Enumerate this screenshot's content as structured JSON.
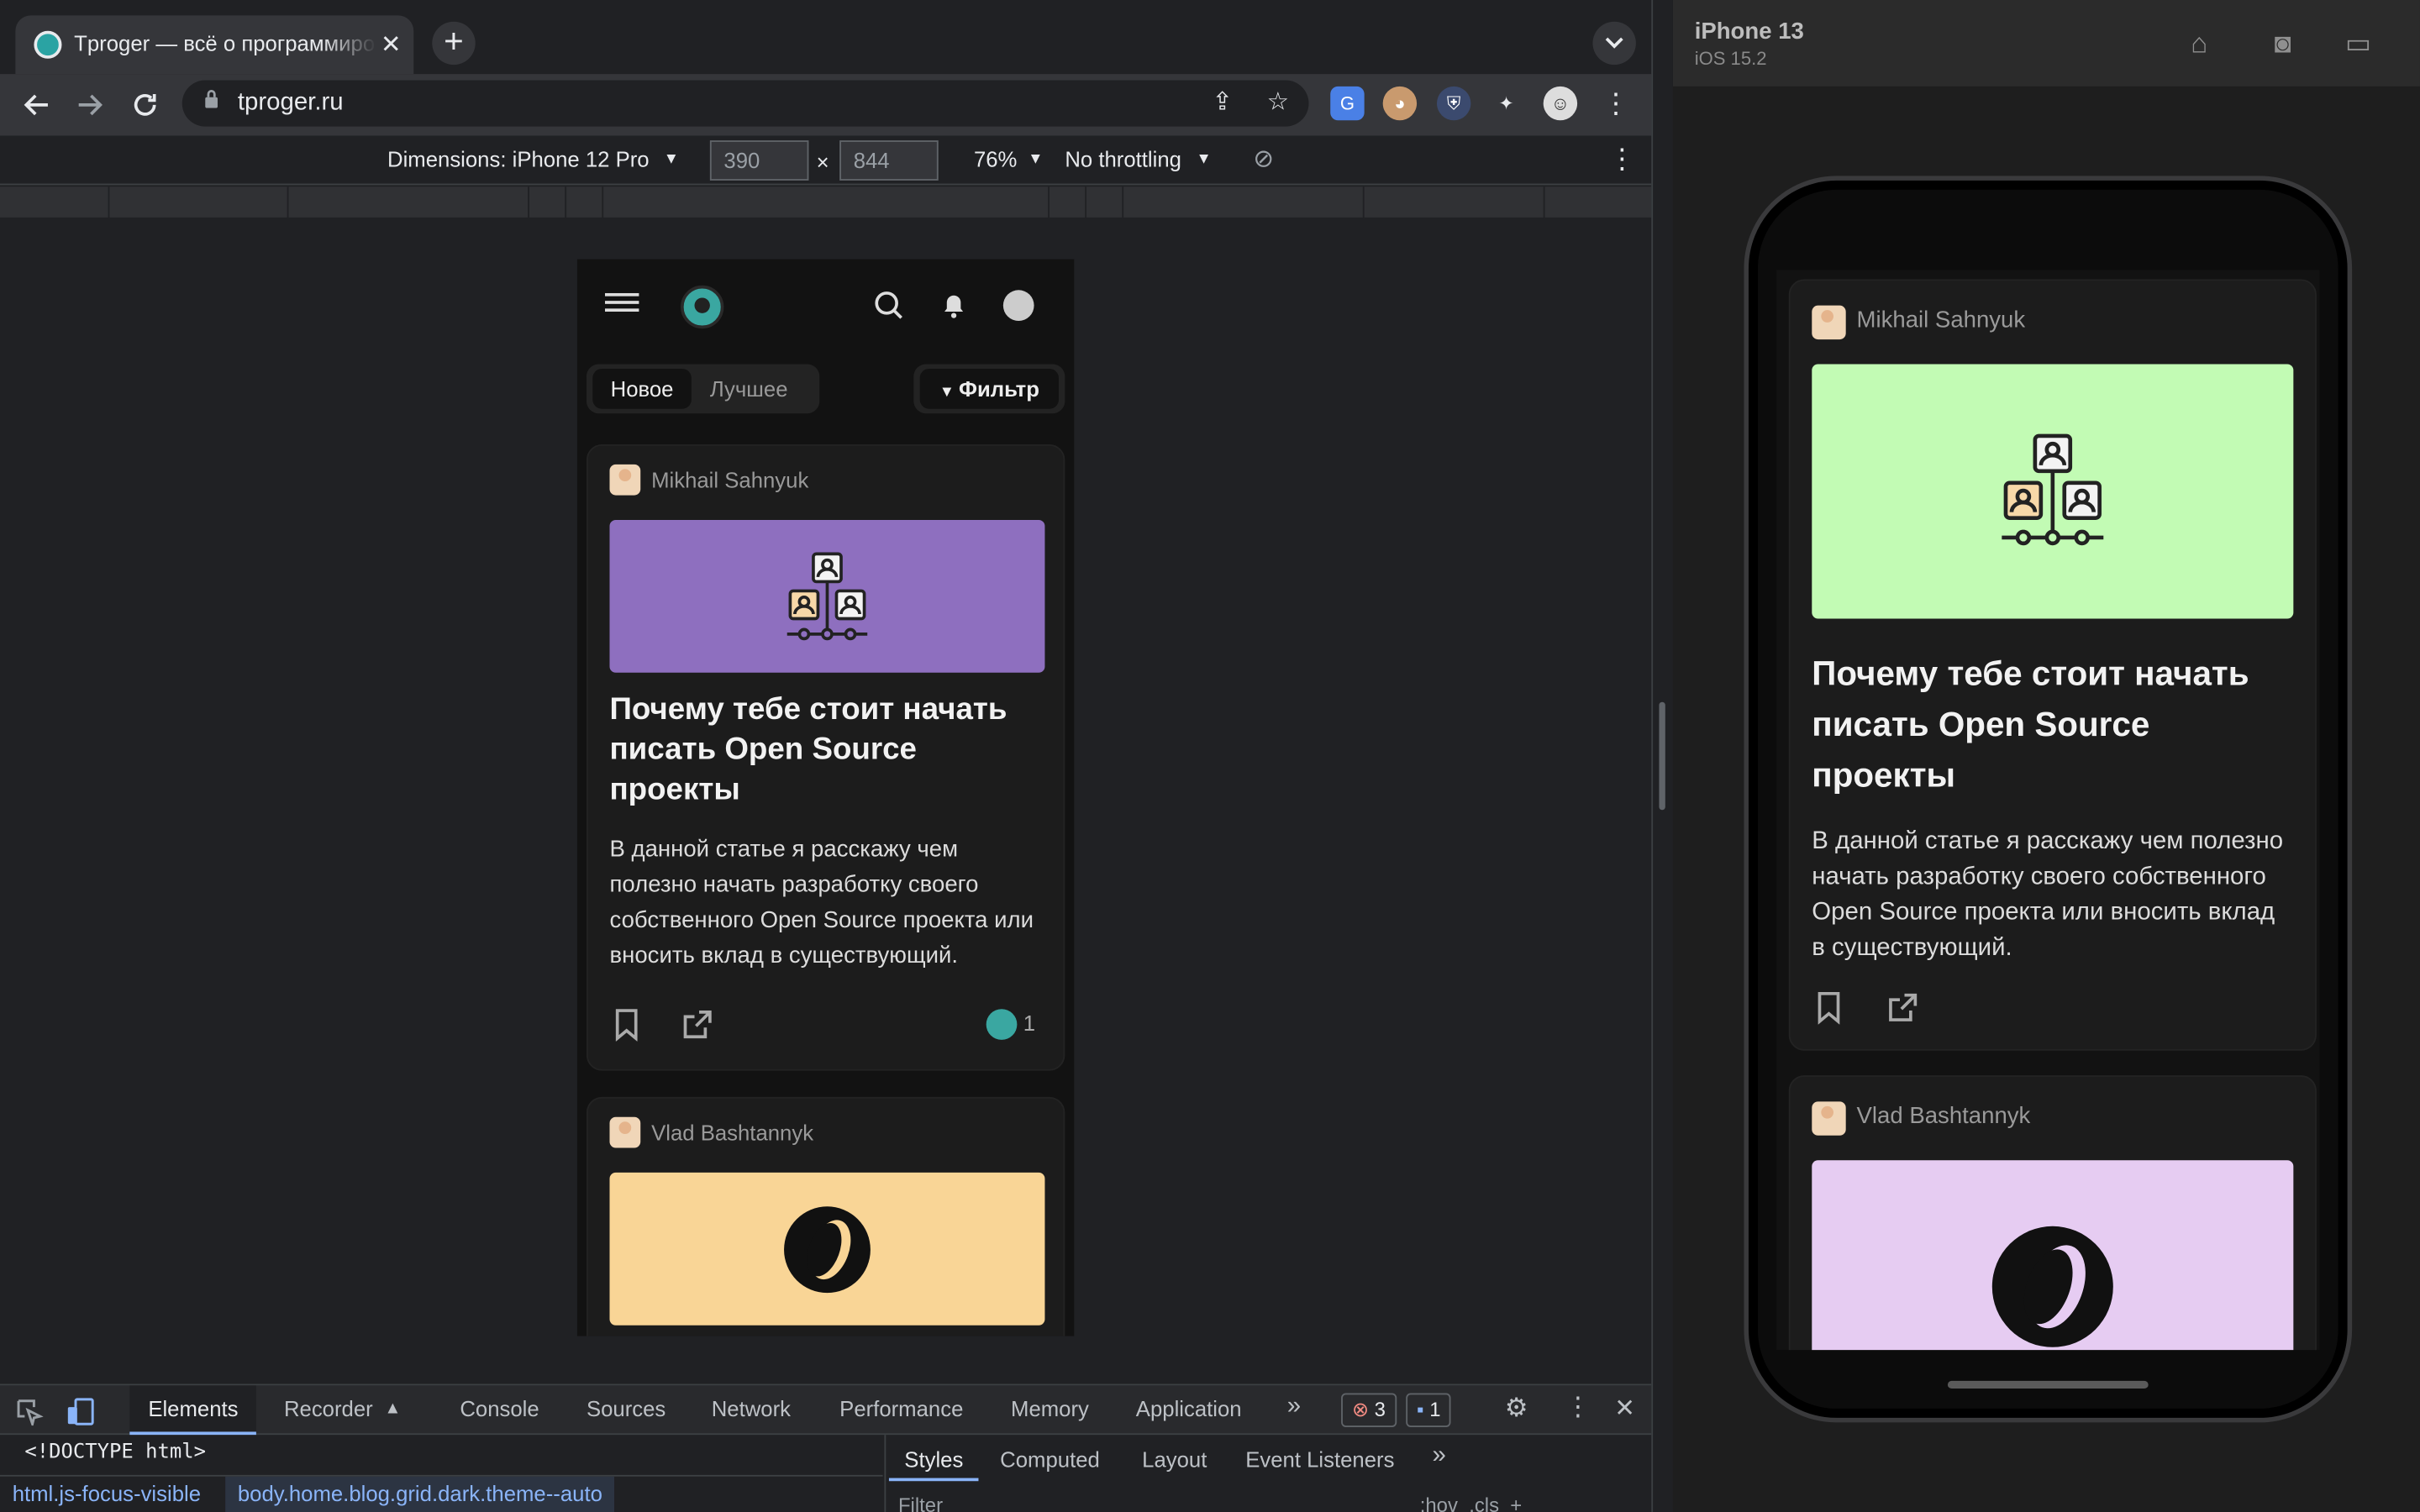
{
  "browser": {
    "tab_title": "Tproger — всё о программировании",
    "url": "tproger.ru",
    "new_tab": "+",
    "tab_search": "⌄"
  },
  "device_toolbar": {
    "dimensions_label": "Dimensions: iPhone 12 Pro",
    "width": "390",
    "height": "844",
    "times": "×",
    "zoom": "76%",
    "throttling": "No throttling"
  },
  "site": {
    "tabs": {
      "new": "Новое",
      "best": "Лучшее"
    },
    "filter_label": "Фильтр",
    "posts": [
      {
        "author": "Mikhail Sahnyuk",
        "title": "Почему тебе стоит начать писать Open Source проекты",
        "excerpt": "В данной статье я расскажу чем полезно начать разработку своего собственного Open Source проекта или вносить вклад в существующий.",
        "likes": "1",
        "cover_color": "#8e6fbf"
      },
      {
        "author": "Vlad Bashtannyk",
        "cover_color": "#f9d596"
      }
    ]
  },
  "devtools": {
    "tabs": [
      "Elements",
      "Recorder",
      "Console",
      "Sources",
      "Network",
      "Performance",
      "Memory",
      "Application"
    ],
    "more": "»",
    "errors": "3",
    "messages": "1",
    "doctype": "<!DOCTYPE html>",
    "crumbs": [
      "html.js-focus-visible",
      "body.home.blog.grid.dark.theme--auto"
    ],
    "style_tabs": [
      "Styles",
      "Computed",
      "Layout",
      "Event Listeners"
    ],
    "filter_placeholder": "Filter",
    "hov": ":hov",
    "cls": ".cls"
  },
  "simulator": {
    "device": "iPhone 13",
    "os": "iOS 15.2",
    "cover_colors": [
      "#c2fbb4",
      "#e6ccf2"
    ]
  }
}
